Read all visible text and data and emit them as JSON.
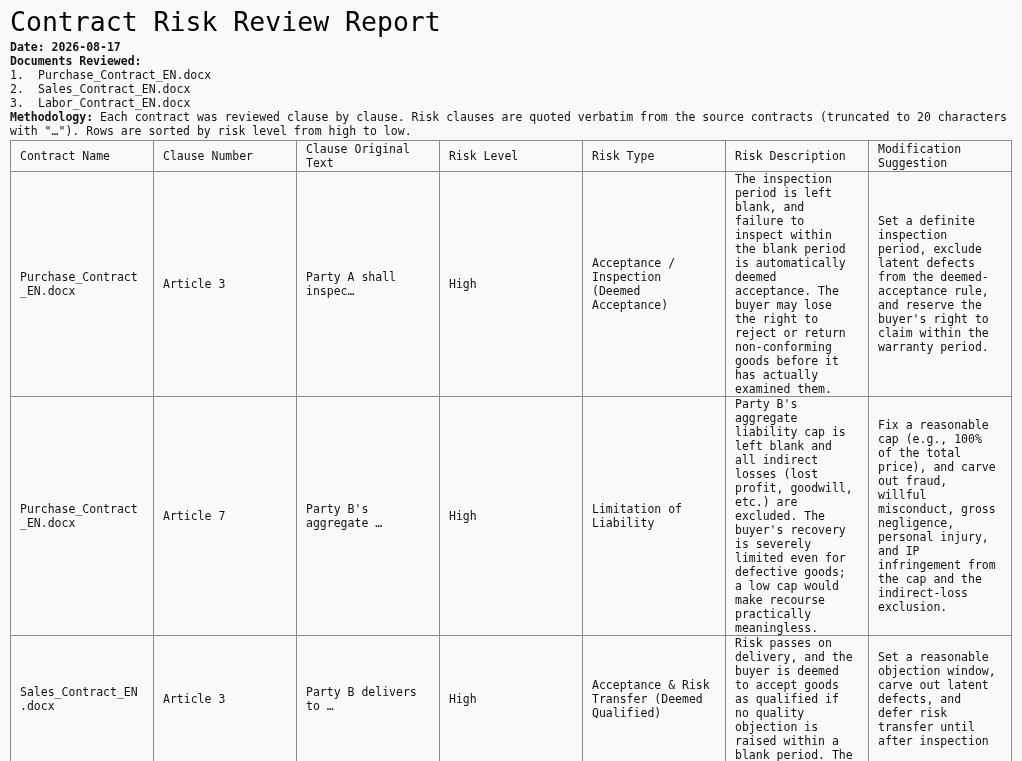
{
  "title": "Contract Risk Review Report",
  "date": "Date: 2026-08-17",
  "documents": {
    "heading": "Documents Reviewed:",
    "items": [
      {
        "number": "1.",
        "name": "Purchase_Contract_EN.docx"
      },
      {
        "number": "2.",
        "name": "Sales_Contract_EN.docx"
      },
      {
        "number": "3.",
        "name": "Labor_Contract_EN.docx"
      }
    ]
  },
  "methodology": "**Methodology:** Each contract was reviewed clause by clause. Risk clauses are quoted verbatim from the source contracts (truncated to 20 characters with \"…\"). Rows are sorted by risk level from high to low.",
  "table": {
    "columns": [
      "Contract Name",
      "Clause Number",
      "Clause Original Text",
      "Risk Level",
      "Risk Type",
      "Risk Description",
      "Modification Suggestion"
    ],
    "rows": [
      [
        "Purchase_Contract_EN.docx",
        "Article 3",
        "Party A shall inspec…",
        "High",
        "Acceptance / Inspection (Deemed Acceptance)",
        "The inspection period is left blank, and failure to inspect within the blank period is automatically deemed acceptance. The buyer may lose the right to reject or return non-conforming goods before it has actually examined them.",
        "Set a definite inspection period, exclude latent defects from the deemed-acceptance rule, and reserve the buyer's right to claim within the warranty period."
      ],
      [
        "Purchase_Contract_EN.docx",
        "Article 7",
        "Party B's aggregate …",
        "High",
        "Limitation of Liability",
        "Party B's aggregate liability cap is left blank and all indirect losses (lost profit, goodwill, etc.) are excluded. The buyer's recovery is severely limited even for defective goods; a low cap would make recourse practically meaningless.",
        "Fix a reasonable cap (e.g., 100% of the total price), and carve out fraud, willful misconduct, gross negligence, personal injury, and IP infringement from the cap and the indirect-loss exclusion."
      ],
      [
        "Sales_Contract_EN.docx",
        "Article 3",
        "Party B delivers to …",
        "High",
        "Acceptance & Risk Transfer (Deemed Qualified)",
        "Risk passes on delivery, and the buyer is deemed to accept goods as qualified if no quality objection is raised within a blank period. The",
        "Set a reasonable objection window, carve out latent defects, and defer risk transfer until after inspection"
      ]
    ]
  }
}
